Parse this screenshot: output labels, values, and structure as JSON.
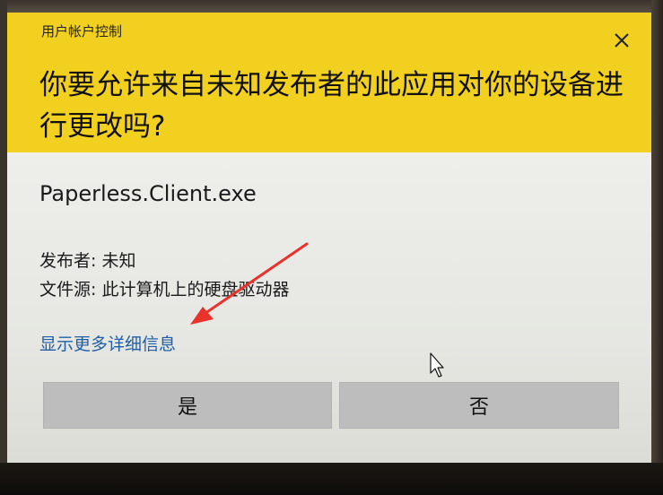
{
  "dialog": {
    "caption": "用户帐户控制",
    "question": "你要允许来自未知发布者的此应用对你的设备进行更改吗?",
    "app_name": "Paperless.Client.exe",
    "publisher_label": "发布者:",
    "publisher_value": "未知",
    "source_label": "文件源:",
    "source_value": "此计算机上的硬盘驱动器",
    "more_info_link": "显示更多详细信息",
    "yes_button": "是",
    "no_button": "否"
  },
  "icons": {
    "close": "close-icon",
    "cursor": "mouse-pointer-icon",
    "annotation": "red-arrow-annotation"
  },
  "colors": {
    "header": "#f2d020",
    "link": "#1f5fa8",
    "button": "#bdbdbd",
    "annotation": "#e8322b"
  }
}
